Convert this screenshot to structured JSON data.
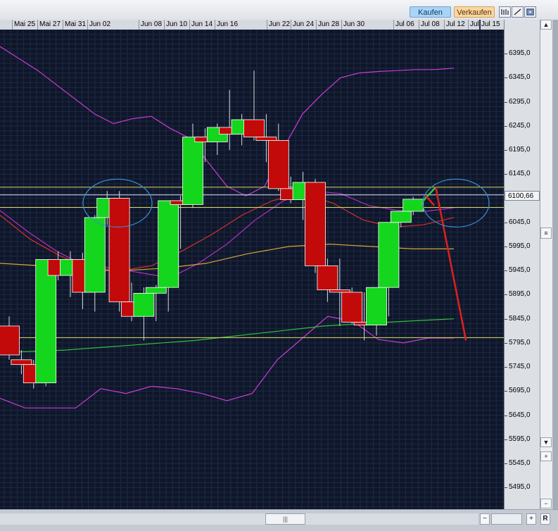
{
  "toolbar": {
    "buy_label": "Kaufen",
    "sell_label": "Verkaufen",
    "tools": [
      "candlestick-icon",
      "draw-line-icon",
      "window-icon"
    ]
  },
  "chart_data": {
    "type": "candlestick",
    "x_tick_labels": [
      "Mai 25",
      "Mai 27",
      "Mai 31",
      "Jun 02",
      "Jun 08",
      "Jun 10",
      "Jun 14",
      "Jun 16",
      "Jun 22",
      "Jun 24",
      "Jun 28",
      "Jun 30",
      "Jul 06",
      "Jul 08",
      "Jul 12",
      "Jul",
      "Jul 15"
    ],
    "y_tick_labels": [
      "6395,0",
      "6345,0",
      "6295,0",
      "6245,0",
      "6195,0",
      "6145,0",
      "6045,0",
      "5995,0",
      "5945,0",
      "5895,0",
      "5845,0",
      "5795,0",
      "5745,0",
      "5695,0",
      "5645,0",
      "5595,0",
      "5545,0",
      "5495,0"
    ],
    "ylim": [
      5450,
      6445
    ],
    "current_price_label": "6100,66",
    "current_price": 6100.66,
    "candles": [
      {
        "o": 5830,
        "h": 5850,
        "l": 5760,
        "c": 5770
      },
      {
        "o": 5760,
        "h": 5780,
        "l": 5730,
        "c": 5750
      },
      {
        "o": 5750,
        "h": 5760,
        "l": 5700,
        "c": 5712
      },
      {
        "o": 5712,
        "h": 5968,
        "l": 5705,
        "c": 5968
      },
      {
        "o": 5968,
        "h": 5985,
        "l": 5925,
        "c": 5935
      },
      {
        "o": 5935,
        "h": 5985,
        "l": 5890,
        "c": 5968
      },
      {
        "o": 5968,
        "h": 5982,
        "l": 5865,
        "c": 5900
      },
      {
        "o": 5900,
        "h": 6060,
        "l": 5860,
        "c": 6055
      },
      {
        "o": 6055,
        "h": 6110,
        "l": 6040,
        "c": 6095
      },
      {
        "o": 6095,
        "h": 6110,
        "l": 5860,
        "c": 5880
      },
      {
        "o": 5880,
        "h": 5920,
        "l": 5840,
        "c": 5850
      },
      {
        "o": 5850,
        "h": 5910,
        "l": 5800,
        "c": 5898
      },
      {
        "o": 5898,
        "h": 5915,
        "l": 5840,
        "c": 5910
      },
      {
        "o": 5910,
        "h": 6090,
        "l": 5860,
        "c": 6090
      },
      {
        "o": 6090,
        "h": 6100,
        "l": 5990,
        "c": 6082
      },
      {
        "o": 6082,
        "h": 6250,
        "l": 6075,
        "c": 6222
      },
      {
        "o": 6222,
        "h": 6240,
        "l": 6170,
        "c": 6212
      },
      {
        "o": 6212,
        "h": 6250,
        "l": 6185,
        "c": 6242
      },
      {
        "o": 6242,
        "h": 6320,
        "l": 6195,
        "c": 6228
      },
      {
        "o": 6228,
        "h": 6270,
        "l": 6205,
        "c": 6258
      },
      {
        "o": 6258,
        "h": 6360,
        "l": 6215,
        "c": 6222
      },
      {
        "o": 6222,
        "h": 6270,
        "l": 6170,
        "c": 6215
      },
      {
        "o": 6215,
        "h": 6250,
        "l": 6110,
        "c": 6115
      },
      {
        "o": 6115,
        "h": 6140,
        "l": 6085,
        "c": 6092
      },
      {
        "o": 6092,
        "h": 6150,
        "l": 6050,
        "c": 6128
      },
      {
        "o": 6128,
        "h": 6135,
        "l": 5940,
        "c": 5955
      },
      {
        "o": 5955,
        "h": 5970,
        "l": 5880,
        "c": 5905
      },
      {
        "o": 5905,
        "h": 5970,
        "l": 5830,
        "c": 5900
      },
      {
        "o": 5900,
        "h": 5910,
        "l": 5835,
        "c": 5838
      },
      {
        "o": 5838,
        "h": 5900,
        "l": 5800,
        "c": 5832
      },
      {
        "o": 5832,
        "h": 5910,
        "l": 5810,
        "c": 5910
      },
      {
        "o": 5910,
        "h": 6045,
        "l": 5850,
        "c": 6045
      },
      {
        "o": 6045,
        "h": 6068,
        "l": 6035,
        "c": 6068
      },
      {
        "o": 6068,
        "h": 6098,
        "l": 6060,
        "c": 6093
      }
    ],
    "forecast_up_segment": {
      "color": "#33cc33",
      "values": [
        6083,
        6118
      ]
    },
    "forecast_down_segment": {
      "color": "#e02020",
      "values": [
        6118,
        5800
      ]
    },
    "horizontal_lines": [
      {
        "value": 6118,
        "color": "#d8d860"
      },
      {
        "value": 6102,
        "color": "#e0e6ff"
      },
      {
        "value": 6076,
        "color": "#d8d860"
      },
      {
        "value": 5806,
        "color": "#d8d860"
      }
    ],
    "bollinger_upper": [
      6410,
      6385,
      6360,
      6330,
      6300,
      6270,
      6250,
      6260,
      6265,
      6240,
      6220,
      6170,
      6120,
      6100,
      6120,
      6200,
      6270,
      6310,
      6345,
      6355,
      6358,
      6360,
      6362,
      6362,
      6365
    ],
    "bollinger_mid": [
      6070,
      6025,
      5985,
      5955,
      5950,
      5940,
      5930,
      5960,
      6000,
      6050,
      6090,
      6110,
      6105,
      6080,
      6070,
      6068,
      6075
    ],
    "bollinger_lower": [
      5680,
      5660,
      5660,
      5660,
      5700,
      5690,
      5705,
      5700,
      5690,
      5675,
      5690,
      5760,
      5805,
      5850,
      5840,
      5802,
      5795,
      5805,
      5805
    ],
    "ma_red": [
      6060,
      6010,
      5975,
      5950,
      5945,
      5955,
      5985,
      6020,
      6060,
      6090,
      6105,
      6085,
      6050,
      6035,
      6040,
      6055
    ],
    "ma_orange": [
      5960,
      5955,
      5945,
      5945,
      5950,
      5960,
      5980,
      5995,
      6000,
      5995,
      5990,
      5990
    ],
    "ma_green": [
      5775,
      5780,
      5790,
      5800,
      5815,
      5830,
      5838,
      5845
    ],
    "ellipses": [
      {
        "color": "#3a8fd0",
        "center": 6085
      },
      {
        "color": "#3a8fd0",
        "center": 6085
      }
    ]
  }
}
